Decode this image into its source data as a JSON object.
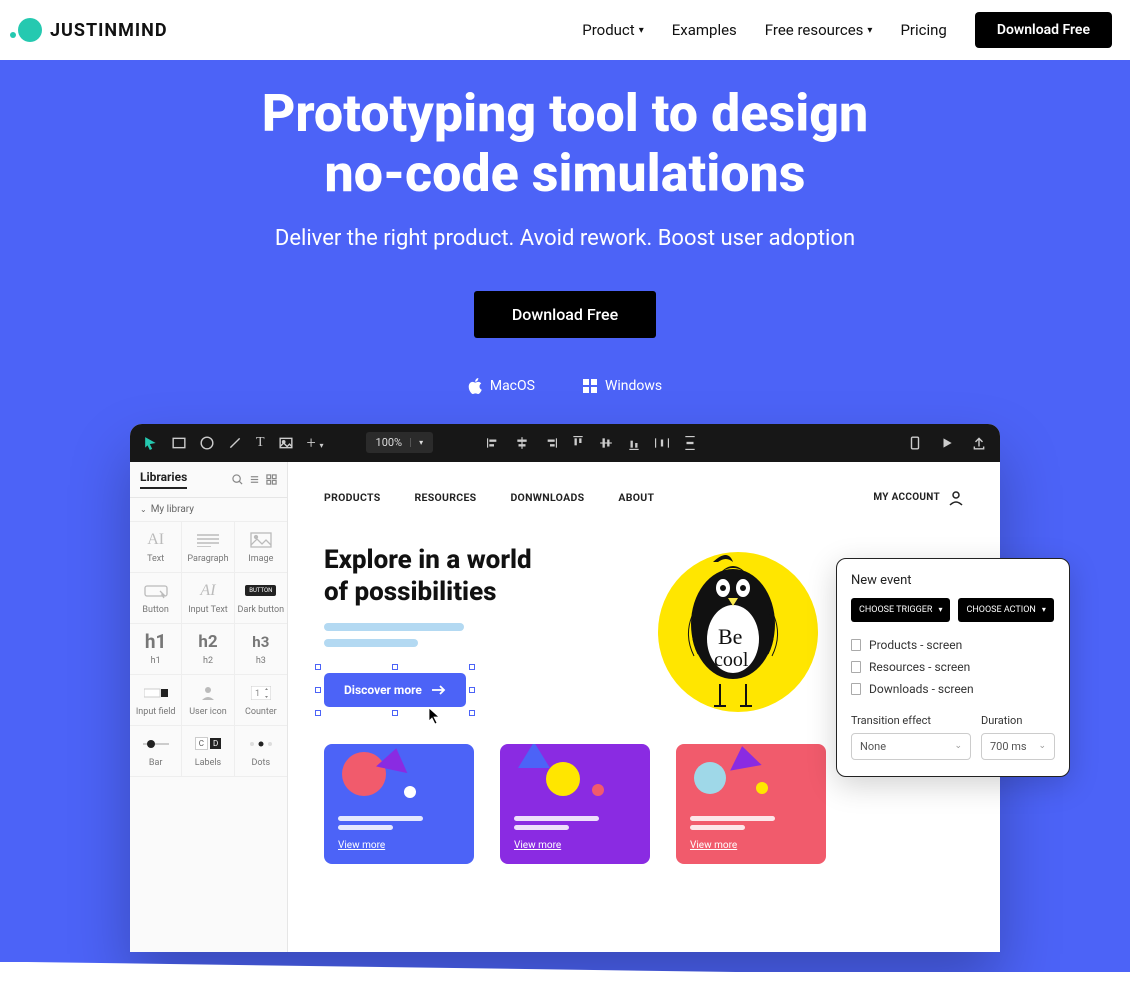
{
  "brand": {
    "name": "JUSTINMIND"
  },
  "nav": {
    "product": "Product",
    "examples": "Examples",
    "free_resources": "Free resources",
    "pricing": "Pricing",
    "download": "Download Free"
  },
  "hero": {
    "title_l1": "Prototyping tool to design",
    "title_l2": "no-code simulations",
    "subtitle": "Deliver the right product. Avoid rework. Boost user adoption",
    "cta": "Download Free",
    "platform_mac": "MacOS",
    "platform_win": "Windows"
  },
  "editor": {
    "zoom": "100%",
    "sidebar": {
      "title": "Libraries",
      "section": "My library",
      "items": {
        "text": "Text",
        "paragraph": "Paragraph",
        "image": "Image",
        "button": "Button",
        "input_text": "Input Text",
        "dark_button_chip": "BUTTON",
        "dark_button": "Dark button",
        "h1": "h1",
        "h1_big": "h1",
        "h2": "h2",
        "h2_big": "h2",
        "h3": "h3",
        "h3_big": "h3",
        "input_field": "Input field",
        "user_icon": "User icon",
        "counter": "Counter",
        "bar": "Bar",
        "labels": "Labels",
        "dots": "Dots"
      }
    },
    "canvas": {
      "nav": {
        "products": "PRODUCTS",
        "resources": "RESOURCES",
        "downloads": "DONWNLOADS",
        "about": "ABOUT",
        "account": "MY ACCOUNT"
      },
      "title_l1": "Explore in a world",
      "title_l2": "of possibilities",
      "cta": "Discover more",
      "card_more": "View more"
    },
    "event_panel": {
      "title": "New event",
      "choose_trigger": "CHOOSE TRIGGER",
      "choose_action": "CHOOSE ACTION",
      "screens": {
        "products": "Products  - screen",
        "resources": "Resources  - screen",
        "downloads": "Downloads  - screen"
      },
      "transition_label": "Transition effect",
      "transition_value": "None",
      "duration_label": "Duration",
      "duration_value": "700 ms"
    }
  }
}
